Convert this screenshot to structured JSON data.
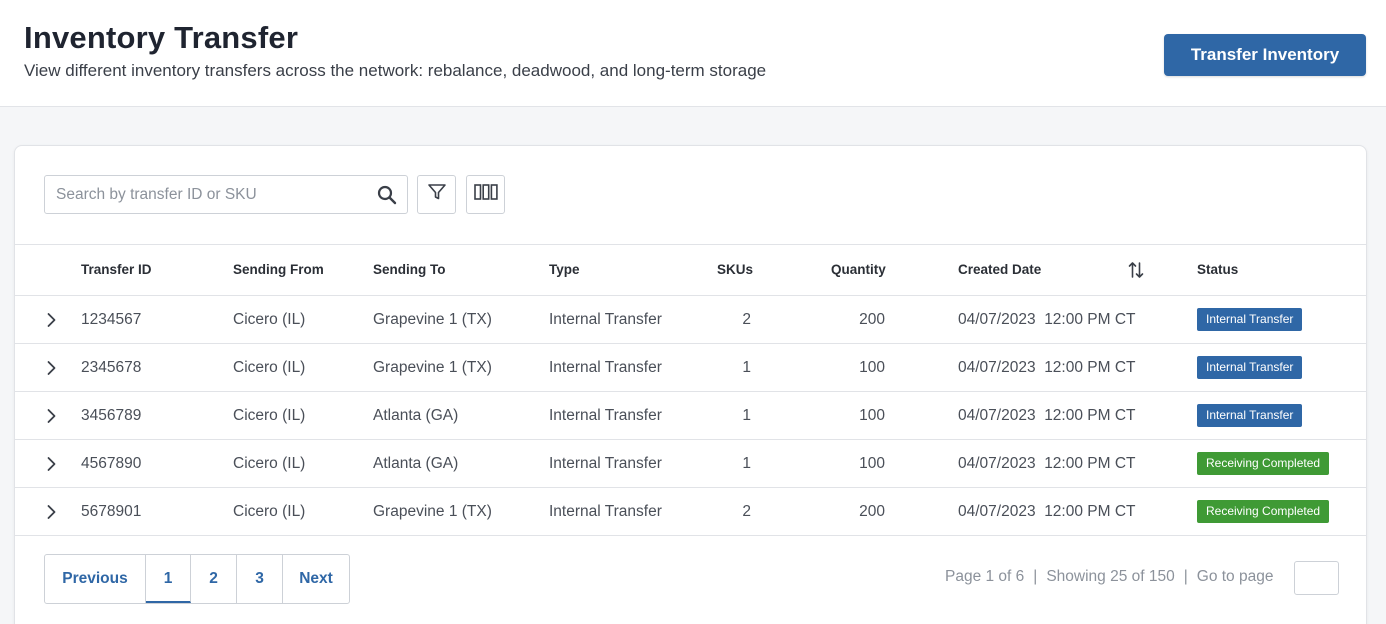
{
  "header": {
    "title": "Inventory Transfer",
    "subtitle": "View different inventory transfers across the network: rebalance, deadwood, and long-term storage",
    "action_label": "Transfer Inventory"
  },
  "toolbar": {
    "search_placeholder": "Search by transfer ID or SKU",
    "search_value": "",
    "icons": [
      "search-icon",
      "filter-icon",
      "columns-icon"
    ]
  },
  "table": {
    "columns": [
      "Transfer ID",
      "Sending From",
      "Sending To",
      "Type",
      "SKUs",
      "Quantity",
      "Created Date",
      "Status"
    ],
    "sort_icon": "sort-updown-icon",
    "rows": [
      {
        "id": "1234567",
        "from": "Cicero (IL)",
        "to": "Grapevine 1 (TX)",
        "type": "Internal Transfer",
        "skus": "2",
        "quantity": "200",
        "created": "04/07/2023  12:00 PM CT",
        "status": "Internal Transfer",
        "status_color": "#2f67a6"
      },
      {
        "id": "2345678",
        "from": "Cicero (IL)",
        "to": "Grapevine 1 (TX)",
        "type": "Internal Transfer",
        "skus": "1",
        "quantity": "100",
        "created": "04/07/2023  12:00 PM CT",
        "status": "Internal Transfer",
        "status_color": "#2f67a6"
      },
      {
        "id": "3456789",
        "from": "Cicero (IL)",
        "to": "Atlanta (GA)",
        "type": "Internal Transfer",
        "skus": "1",
        "quantity": "100",
        "created": "04/07/2023  12:00 PM CT",
        "status": "Internal Transfer",
        "status_color": "#2f67a6"
      },
      {
        "id": "4567890",
        "from": "Cicero (IL)",
        "to": "Atlanta (GA)",
        "type": "Internal Transfer",
        "skus": "1",
        "quantity": "100",
        "created": "04/07/2023  12:00 PM CT",
        "status": "Receiving Completed",
        "status_color": "#3f9a35"
      },
      {
        "id": "5678901",
        "from": "Cicero (IL)",
        "to": "Grapevine 1 (TX)",
        "type": "Internal Transfer",
        "skus": "2",
        "quantity": "200",
        "created": "04/07/2023  12:00 PM CT",
        "status": "Receiving Completed",
        "status_color": "#3f9a35"
      }
    ]
  },
  "pagination": {
    "previous_label": "Previous",
    "pages": [
      "1",
      "2",
      "3"
    ],
    "current_page": "1",
    "next_label": "Next",
    "page_text": "Page 1 of 6",
    "showing_text": "Showing 25 of 150",
    "goto_label": "Go to page",
    "goto_value": ""
  },
  "colors": {
    "accent": "#2f67a6",
    "status_internal": "#2f67a6",
    "status_completed": "#3f9a35"
  }
}
